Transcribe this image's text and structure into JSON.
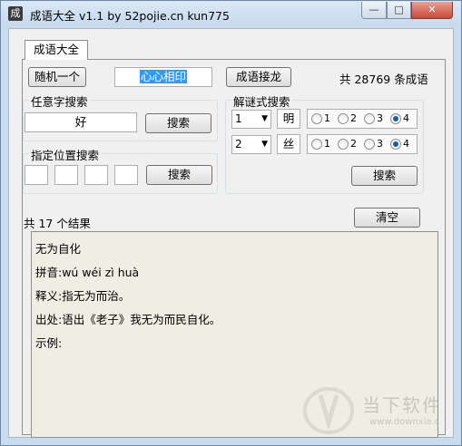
{
  "window": {
    "app_icon": "成",
    "title": "成语大全 v1.1 by 52pojie.cn kun775",
    "min_icon": "minimize-icon",
    "max_icon": "maximize-icon",
    "close_icon": "close-icon"
  },
  "tab": {
    "label": "成语大全"
  },
  "top": {
    "random_button": "随机一个",
    "idiom_field": "心心相印",
    "chain_button": "成语接龙",
    "count_text": "共 28769 条成语"
  },
  "any_search": {
    "title": "任意字搜索",
    "value": "好",
    "button": "搜索"
  },
  "pos_search": {
    "title": "指定位置搜索",
    "values": [
      "",
      "",
      "",
      ""
    ],
    "button": "搜索"
  },
  "riddle_search": {
    "title": "解谜式搜索",
    "rows": [
      {
        "combo": "1",
        "char": "明",
        "options": [
          "1",
          "2",
          "3",
          "4"
        ],
        "selected": "4"
      },
      {
        "combo": "2",
        "char": "丝",
        "options": [
          "1",
          "2",
          "3",
          "4"
        ],
        "selected": "4"
      }
    ],
    "button": "搜索"
  },
  "results": {
    "count_text": "共 17 个结果",
    "clear_button": "清空",
    "lines": [
      "无为自化",
      "拼音:wú wéi zì huà",
      "释义:指无为而治。",
      "出处:语出《老子》我无为而民自化。",
      "示例:"
    ]
  },
  "watermark": {
    "text": "当下软件园",
    "url": "www.downxia.com"
  },
  "colors": {
    "selection": "#3399ff",
    "result_bg": "#f0ede3",
    "frame": "#c9dcef",
    "close": "#c64a35"
  }
}
